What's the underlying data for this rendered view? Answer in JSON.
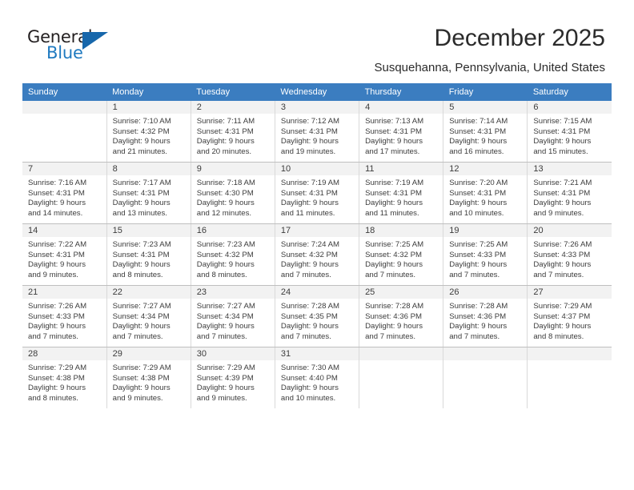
{
  "brand": {
    "name_top": "General",
    "name_bottom": "Blue",
    "accent_color": "#1767ab",
    "text_color": "#231f20"
  },
  "header": {
    "title": "December 2025",
    "subtitle": "Susquehanna, Pennsylvania, United States"
  },
  "calendar": {
    "header_bg": "#3b7dc0",
    "header_text_color": "#ffffff",
    "daynum_bg": "#f2f2f2",
    "weekday_headers": [
      "Sunday",
      "Monday",
      "Tuesday",
      "Wednesday",
      "Thursday",
      "Friday",
      "Saturday"
    ],
    "weeks": [
      [
        {
          "day": "",
          "sunrise": "",
          "sunset": "",
          "daylight_line1": "",
          "daylight_line2": ""
        },
        {
          "day": "1",
          "sunrise": "Sunrise: 7:10 AM",
          "sunset": "Sunset: 4:32 PM",
          "daylight_line1": "Daylight: 9 hours",
          "daylight_line2": "and 21 minutes."
        },
        {
          "day": "2",
          "sunrise": "Sunrise: 7:11 AM",
          "sunset": "Sunset: 4:31 PM",
          "daylight_line1": "Daylight: 9 hours",
          "daylight_line2": "and 20 minutes."
        },
        {
          "day": "3",
          "sunrise": "Sunrise: 7:12 AM",
          "sunset": "Sunset: 4:31 PM",
          "daylight_line1": "Daylight: 9 hours",
          "daylight_line2": "and 19 minutes."
        },
        {
          "day": "4",
          "sunrise": "Sunrise: 7:13 AM",
          "sunset": "Sunset: 4:31 PM",
          "daylight_line1": "Daylight: 9 hours",
          "daylight_line2": "and 17 minutes."
        },
        {
          "day": "5",
          "sunrise": "Sunrise: 7:14 AM",
          "sunset": "Sunset: 4:31 PM",
          "daylight_line1": "Daylight: 9 hours",
          "daylight_line2": "and 16 minutes."
        },
        {
          "day": "6",
          "sunrise": "Sunrise: 7:15 AM",
          "sunset": "Sunset: 4:31 PM",
          "daylight_line1": "Daylight: 9 hours",
          "daylight_line2": "and 15 minutes."
        }
      ],
      [
        {
          "day": "7",
          "sunrise": "Sunrise: 7:16 AM",
          "sunset": "Sunset: 4:31 PM",
          "daylight_line1": "Daylight: 9 hours",
          "daylight_line2": "and 14 minutes."
        },
        {
          "day": "8",
          "sunrise": "Sunrise: 7:17 AM",
          "sunset": "Sunset: 4:31 PM",
          "daylight_line1": "Daylight: 9 hours",
          "daylight_line2": "and 13 minutes."
        },
        {
          "day": "9",
          "sunrise": "Sunrise: 7:18 AM",
          "sunset": "Sunset: 4:30 PM",
          "daylight_line1": "Daylight: 9 hours",
          "daylight_line2": "and 12 minutes."
        },
        {
          "day": "10",
          "sunrise": "Sunrise: 7:19 AM",
          "sunset": "Sunset: 4:31 PM",
          "daylight_line1": "Daylight: 9 hours",
          "daylight_line2": "and 11 minutes."
        },
        {
          "day": "11",
          "sunrise": "Sunrise: 7:19 AM",
          "sunset": "Sunset: 4:31 PM",
          "daylight_line1": "Daylight: 9 hours",
          "daylight_line2": "and 11 minutes."
        },
        {
          "day": "12",
          "sunrise": "Sunrise: 7:20 AM",
          "sunset": "Sunset: 4:31 PM",
          "daylight_line1": "Daylight: 9 hours",
          "daylight_line2": "and 10 minutes."
        },
        {
          "day": "13",
          "sunrise": "Sunrise: 7:21 AM",
          "sunset": "Sunset: 4:31 PM",
          "daylight_line1": "Daylight: 9 hours",
          "daylight_line2": "and 9 minutes."
        }
      ],
      [
        {
          "day": "14",
          "sunrise": "Sunrise: 7:22 AM",
          "sunset": "Sunset: 4:31 PM",
          "daylight_line1": "Daylight: 9 hours",
          "daylight_line2": "and 9 minutes."
        },
        {
          "day": "15",
          "sunrise": "Sunrise: 7:23 AM",
          "sunset": "Sunset: 4:31 PM",
          "daylight_line1": "Daylight: 9 hours",
          "daylight_line2": "and 8 minutes."
        },
        {
          "day": "16",
          "sunrise": "Sunrise: 7:23 AM",
          "sunset": "Sunset: 4:32 PM",
          "daylight_line1": "Daylight: 9 hours",
          "daylight_line2": "and 8 minutes."
        },
        {
          "day": "17",
          "sunrise": "Sunrise: 7:24 AM",
          "sunset": "Sunset: 4:32 PM",
          "daylight_line1": "Daylight: 9 hours",
          "daylight_line2": "and 7 minutes."
        },
        {
          "day": "18",
          "sunrise": "Sunrise: 7:25 AM",
          "sunset": "Sunset: 4:32 PM",
          "daylight_line1": "Daylight: 9 hours",
          "daylight_line2": "and 7 minutes."
        },
        {
          "day": "19",
          "sunrise": "Sunrise: 7:25 AM",
          "sunset": "Sunset: 4:33 PM",
          "daylight_line1": "Daylight: 9 hours",
          "daylight_line2": "and 7 minutes."
        },
        {
          "day": "20",
          "sunrise": "Sunrise: 7:26 AM",
          "sunset": "Sunset: 4:33 PM",
          "daylight_line1": "Daylight: 9 hours",
          "daylight_line2": "and 7 minutes."
        }
      ],
      [
        {
          "day": "21",
          "sunrise": "Sunrise: 7:26 AM",
          "sunset": "Sunset: 4:33 PM",
          "daylight_line1": "Daylight: 9 hours",
          "daylight_line2": "and 7 minutes."
        },
        {
          "day": "22",
          "sunrise": "Sunrise: 7:27 AM",
          "sunset": "Sunset: 4:34 PM",
          "daylight_line1": "Daylight: 9 hours",
          "daylight_line2": "and 7 minutes."
        },
        {
          "day": "23",
          "sunrise": "Sunrise: 7:27 AM",
          "sunset": "Sunset: 4:34 PM",
          "daylight_line1": "Daylight: 9 hours",
          "daylight_line2": "and 7 minutes."
        },
        {
          "day": "24",
          "sunrise": "Sunrise: 7:28 AM",
          "sunset": "Sunset: 4:35 PM",
          "daylight_line1": "Daylight: 9 hours",
          "daylight_line2": "and 7 minutes."
        },
        {
          "day": "25",
          "sunrise": "Sunrise: 7:28 AM",
          "sunset": "Sunset: 4:36 PM",
          "daylight_line1": "Daylight: 9 hours",
          "daylight_line2": "and 7 minutes."
        },
        {
          "day": "26",
          "sunrise": "Sunrise: 7:28 AM",
          "sunset": "Sunset: 4:36 PM",
          "daylight_line1": "Daylight: 9 hours",
          "daylight_line2": "and 7 minutes."
        },
        {
          "day": "27",
          "sunrise": "Sunrise: 7:29 AM",
          "sunset": "Sunset: 4:37 PM",
          "daylight_line1": "Daylight: 9 hours",
          "daylight_line2": "and 8 minutes."
        }
      ],
      [
        {
          "day": "28",
          "sunrise": "Sunrise: 7:29 AM",
          "sunset": "Sunset: 4:38 PM",
          "daylight_line1": "Daylight: 9 hours",
          "daylight_line2": "and 8 minutes."
        },
        {
          "day": "29",
          "sunrise": "Sunrise: 7:29 AM",
          "sunset": "Sunset: 4:38 PM",
          "daylight_line1": "Daylight: 9 hours",
          "daylight_line2": "and 9 minutes."
        },
        {
          "day": "30",
          "sunrise": "Sunrise: 7:29 AM",
          "sunset": "Sunset: 4:39 PM",
          "daylight_line1": "Daylight: 9 hours",
          "daylight_line2": "and 9 minutes."
        },
        {
          "day": "31",
          "sunrise": "Sunrise: 7:30 AM",
          "sunset": "Sunset: 4:40 PM",
          "daylight_line1": "Daylight: 9 hours",
          "daylight_line2": "and 10 minutes."
        },
        {
          "day": "",
          "sunrise": "",
          "sunset": "",
          "daylight_line1": "",
          "daylight_line2": ""
        },
        {
          "day": "",
          "sunrise": "",
          "sunset": "",
          "daylight_line1": "",
          "daylight_line2": ""
        },
        {
          "day": "",
          "sunrise": "",
          "sunset": "",
          "daylight_line1": "",
          "daylight_line2": ""
        }
      ]
    ]
  }
}
